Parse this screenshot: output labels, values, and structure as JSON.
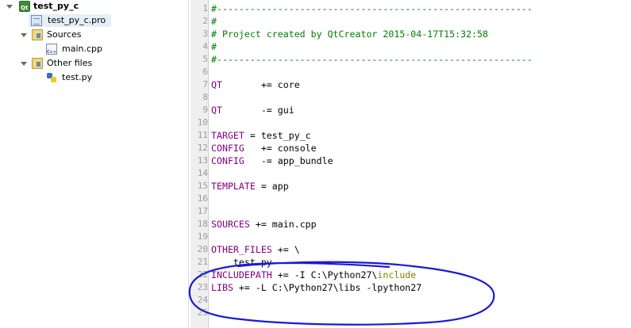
{
  "tree": {
    "project": "test_py_c",
    "pro_file": "test_py_c.pro",
    "sources_folder": "Sources",
    "main_cpp": "main.cpp",
    "other_folder": "Other files",
    "test_py": "test.py"
  },
  "editor": {
    "lines": [
      {
        "n": "1",
        "parts": [
          {
            "t": "#---------------------------------------------------------",
            "c": "comment"
          }
        ]
      },
      {
        "n": "2",
        "parts": [
          {
            "t": "#",
            "c": "comment"
          }
        ]
      },
      {
        "n": "3",
        "parts": [
          {
            "t": "# Project created by QtCreator 2015-04-17T15:32:58",
            "c": "comment"
          }
        ]
      },
      {
        "n": "4",
        "parts": [
          {
            "t": "#",
            "c": "comment"
          }
        ]
      },
      {
        "n": "5",
        "parts": [
          {
            "t": "#---------------------------------------------------------",
            "c": "comment"
          }
        ]
      },
      {
        "n": "6",
        "parts": []
      },
      {
        "n": "7",
        "parts": [
          {
            "t": "QT",
            "c": "kw"
          },
          {
            "t": "       += core",
            "c": "plain"
          }
        ]
      },
      {
        "n": "8",
        "parts": []
      },
      {
        "n": "9",
        "parts": [
          {
            "t": "QT",
            "c": "kw"
          },
          {
            "t": "       -= gui",
            "c": "plain"
          }
        ]
      },
      {
        "n": "10",
        "parts": []
      },
      {
        "n": "11",
        "parts": [
          {
            "t": "TARGET",
            "c": "kw"
          },
          {
            "t": " = test_py_c",
            "c": "plain"
          }
        ]
      },
      {
        "n": "12",
        "parts": [
          {
            "t": "CONFIG",
            "c": "kw"
          },
          {
            "t": "   += console",
            "c": "plain"
          }
        ]
      },
      {
        "n": "13",
        "parts": [
          {
            "t": "CONFIG",
            "c": "kw"
          },
          {
            "t": "   -= app_bundle",
            "c": "plain"
          }
        ]
      },
      {
        "n": "14",
        "parts": []
      },
      {
        "n": "15",
        "parts": [
          {
            "t": "TEMPLATE",
            "c": "kw"
          },
          {
            "t": " = app",
            "c": "plain"
          }
        ]
      },
      {
        "n": "16",
        "parts": []
      },
      {
        "n": "17",
        "parts": []
      },
      {
        "n": "18",
        "parts": [
          {
            "t": "SOURCES",
            "c": "kw"
          },
          {
            "t": " += main.cpp",
            "c": "plain"
          }
        ]
      },
      {
        "n": "19",
        "parts": []
      },
      {
        "n": "20",
        "parts": [
          {
            "t": "OTHER_FILES",
            "c": "kw"
          },
          {
            "t": " += \\",
            "c": "plain"
          }
        ]
      },
      {
        "n": "21",
        "parts": [
          {
            "t": "    test.py",
            "c": "plain"
          }
        ]
      },
      {
        "n": "22",
        "parts": [
          {
            "t": "INCLUDEPATH",
            "c": "kw"
          },
          {
            "t": " += -I C:\\Python27\\",
            "c": "plain"
          },
          {
            "t": "include",
            "c": "str"
          }
        ]
      },
      {
        "n": "23",
        "parts": [
          {
            "t": "LIBS",
            "c": "kw"
          },
          {
            "t": " += -L C:\\Python27\\libs -lpython27",
            "c": "plain"
          }
        ]
      },
      {
        "n": "24",
        "parts": []
      },
      {
        "n": "25",
        "parts": []
      }
    ]
  },
  "colors": {
    "comment": "#008000",
    "keyword": "#800080",
    "string": "#808000",
    "annotation": "#1a1ad6"
  }
}
